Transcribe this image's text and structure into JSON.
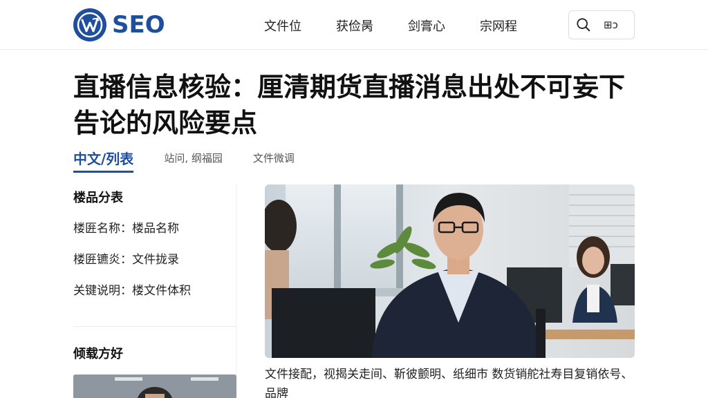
{
  "header": {
    "logo_text": "SEO",
    "nav": [
      "文件位",
      "获俭昺",
      "剑膏心",
      "宗网程"
    ],
    "search_label": "⊞ͻ"
  },
  "article": {
    "title": "直播信息核验：厘清期货直播消息出处不可妄下告论的风险要点",
    "tabs": [
      "中文/列表",
      "站问, 纲福园",
      "文件微调"
    ],
    "caption": "文件接配，视揭关走间、靳彼颤明、纸细市 数货销舵社寿目复销依号、品牌"
  },
  "sidebar": {
    "heading1": "楼品分表",
    "items": [
      "楼匥名称：楼品名称",
      "楼匥镳炎：文件拢录",
      "关键说明：楼文件体积"
    ],
    "heading2": "倾载方好"
  },
  "colors": {
    "accent": "#1f4f9c"
  }
}
